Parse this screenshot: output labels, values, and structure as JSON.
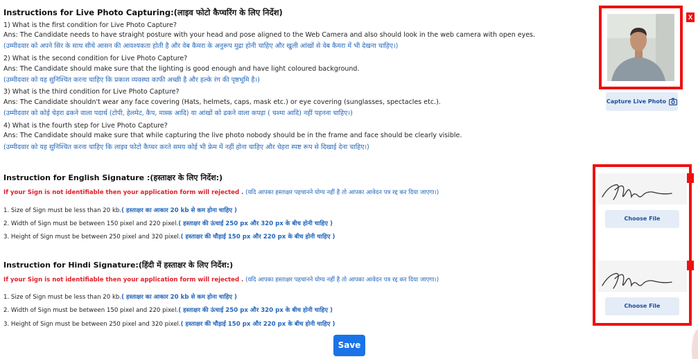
{
  "photo_section": {
    "title": "Instructions for Live Photo Capturing:(लाइव फोटो कैप्चरिंग के लिए निर्देश)",
    "items": [
      {
        "q": "1) What is the first condition for Live Photo Capture?",
        "a": "Ans: The Candidate needs to have straight posture with your head and pose aligned to the Web Camera and also should look in the web camera with open eyes.",
        "hi": "(उम्मीदवार को अपने सिर के साथ सीधे आसन की आवश्यकता होती है और वेब कैमरा के अनुरूप मुद्रा होनी चाहिए और खुली आंखों से वेब कैमरा में भी देखना चाहिए।)"
      },
      {
        "q": "2) What is the second condition for Live Photo Capture?",
        "a": "Ans: The Candidate should make sure that the lighting is good enough and have light coloured background.",
        "hi": "(उम्मीदवार को यह सुनिश्चित करना चाहिए कि प्रकाश व्यवस्था काफी अच्छी है और हल्के रंग की पृष्ठभूमि है।)"
      },
      {
        "q": "3) What is the third condition for Live Photo Capture?",
        "a": "Ans: The Candidate shouldn't wear any face covering (Hats, helmets, caps, mask etc.) or eye covering (sunglasses, spectacles etc.).",
        "hi": "(उम्मीदवार को कोई चेहरा ढकने वाला पदार्थ (टोपी, हेलमेट, कैप, मास्क आदि) या आंखों को ढकने वाला कपड़ा ( चश्मा आदि) नहीं पहनना चाहिए।)"
      },
      {
        "q": "4) What is the fourth step for Live Photo Capture?",
        "a": "Ans: The Candidate should make sure that while capturing the live photo nobody should be in the frame and face should be clearly visible.",
        "hi": "(उम्मीदवार को यह सुनिश्चित करना चाहिए कि लाइव फोटो कैप्चर करते समय कोई भी फ्रेम में नहीं होना चाहिए और चेहरा स्पष्ट रूप से दिखाई देना चाहिए।)"
      }
    ],
    "capture_label": "Capture Live Photo",
    "close_label": "X"
  },
  "english_sign": {
    "title": "Instruction for English Signature :(हस्ताक्षर के लिए निर्देश:)",
    "warn_en": "If your Sign is not identifiable then your application form will rejected .",
    "warn_hi": "(यदि आपका हस्ताक्षर पहचानने योग्य नहीं है तो आपका आवेदन पत्र रद्द कर दिया जाएगा।)",
    "rules": [
      {
        "en": "1. Size of Sign must be less than 20 kb.",
        "hi": "( हस्ताक्षर का आकार 20 kb से कम होना चाहिए )"
      },
      {
        "en": "2. Width of Sign must be between 150 pixel and 220 pixel.",
        "hi": "( हस्ताक्षर की ऊंचाई 250 px और 320 px के बीच होनी चाहिए )"
      },
      {
        "en": "3. Height of Sign must be between 250 pixel and 320 pixel.",
        "hi": "( हस्ताक्षर की चौड़ाई 150 px और 220 px के बीच होनी चाहिए )"
      }
    ],
    "choose_label": "Choose File"
  },
  "hindi_sign": {
    "title": "Instruction for Hindi Signature:(हिंदी में हस्ताक्षर के लिए निर्देश:)",
    "warn_en": "If your Sign is not identifiable then your application form will rejected .",
    "warn_hi": "(यदि आपका हस्ताक्षर पहचानने योग्य नहीं है तो आपका आवेदन पत्र रद्द कर दिया जाएगा।)",
    "rules": [
      {
        "en": "1. Size of Sign must be less than 20 kb.",
        "hi": "( हस्ताक्षर का आकार 20 kb से कम होना चाहिए )"
      },
      {
        "en": "2. Width of Sign must be between 150 pixel and 220 pixel.",
        "hi": "( हस्ताक्षर की ऊंचाई 250 px और 320 px के बीच होनी चाहिए )"
      },
      {
        "en": "3. Height of Sign must be between 250 pixel and 320 pixel.",
        "hi": "( हस्ताक्षर की चौड़ाई 150 px और 220 px के बीच होनी चाहिए )"
      }
    ],
    "choose_label": "Choose File"
  },
  "save_label": "Save",
  "icons": {
    "camera": "camera-icon"
  },
  "colors": {
    "accent": "#1a73e8",
    "alert": "#ee1111",
    "hindi_text": "#2266bb"
  }
}
